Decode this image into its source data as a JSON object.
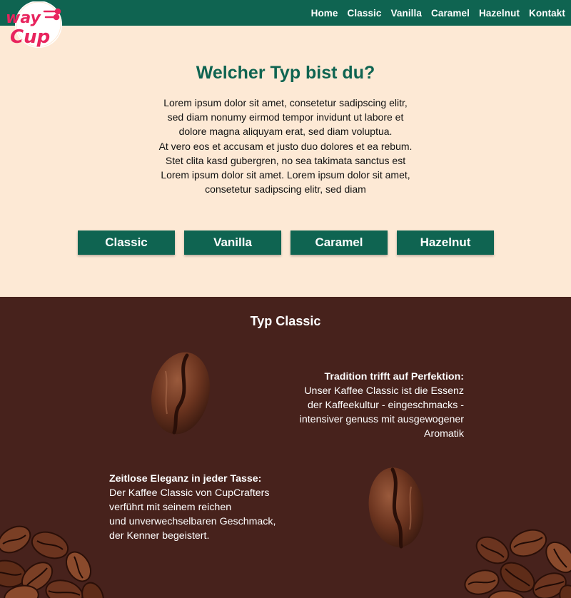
{
  "brand": {
    "logo_line1": "way",
    "logo_line2": "Cup",
    "primary_color": "#0f6451",
    "accent_color": "#e8245e"
  },
  "nav": {
    "links": [
      "Home",
      "Classic",
      "Vanilla",
      "Caramel",
      "Hazelnut",
      "Kontakt"
    ]
  },
  "hero": {
    "title": "Welcher Typ bist du?",
    "text_lines": [
      "Lorem ipsum dolor sit amet, consetetur sadipscing elitr,",
      "sed diam nonumy eirmod tempor invidunt ut labore et",
      "dolore magna aliquyam erat, sed diam voluptua.",
      "At vero eos et accusam et justo duo dolores et ea rebum.",
      "Stet clita kasd gubergren, no sea takimata sanctus est",
      "Lorem ipsum dolor sit amet. Lorem ipsum dolor sit amet,",
      "consetetur sadipscing elitr, sed diam"
    ],
    "buttons": [
      "Classic",
      "Vanilla",
      "Caramel",
      "Hazelnut"
    ]
  },
  "classic": {
    "title": "Typ Classic",
    "block1": {
      "heading": "Tradition trifft auf Perfektion:",
      "lines": [
        "Unser Kaffee Classic ist die Essenz",
        "der Kaffeekultur - eingeschmacks -",
        "intensiver genuss mit ausgewogener",
        "Aromatik"
      ]
    },
    "block2": {
      "heading": "Zeitlose Eleganz in jeder Tasse:",
      "lines": [
        "Der Kaffee Classic von CupCrafters",
        "verführt mit seinem reichen",
        "und unverwechselbaren Geschmack,",
        "der Kenner begeistert."
      ]
    },
    "background_color": "#47221c"
  }
}
